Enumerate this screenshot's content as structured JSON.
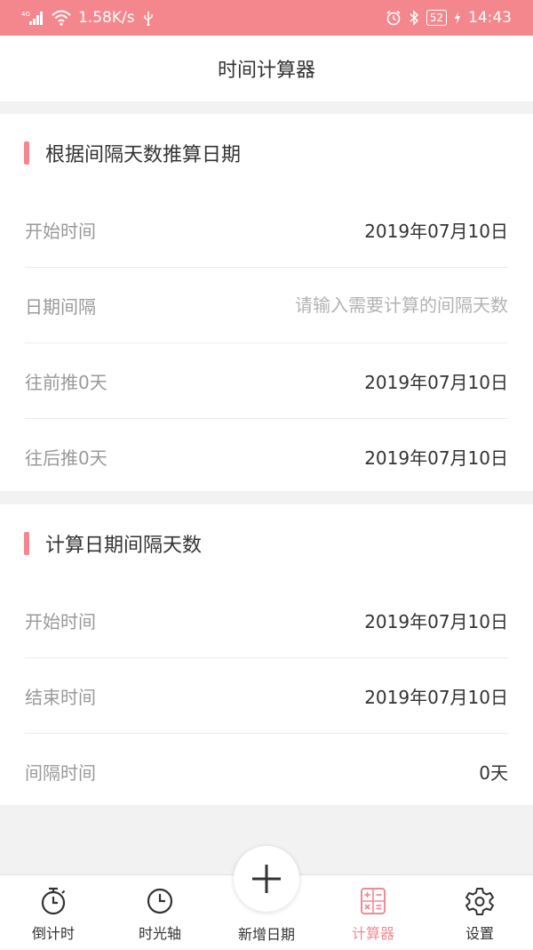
{
  "status_bar": {
    "network": "4G",
    "speed": "1.58K/s",
    "battery": "52",
    "time": "14:43"
  },
  "header": {
    "title": "时间计算器"
  },
  "section_interval": {
    "title": "根据间隔天数推算日期",
    "start_label": "开始时间",
    "start_value": "2019年07月10日",
    "interval_label": "日期间隔",
    "interval_placeholder": "请输入需要计算的间隔天数",
    "forward_label": "往前推0天",
    "forward_value": "2019年07月10日",
    "backward_label": "往后推0天",
    "backward_value": "2019年07月10日"
  },
  "section_diff": {
    "title": "计算日期间隔天数",
    "start_label": "开始时间",
    "start_value": "2019年07月10日",
    "end_label": "结束时间",
    "end_value": "2019年07月10日",
    "diff_label": "间隔时间",
    "diff_value": "0天"
  },
  "tabs": [
    {
      "label": "倒计时",
      "icon": "stopwatch-icon"
    },
    {
      "label": "时光轴",
      "icon": "clock-icon"
    },
    {
      "label": "新增日期",
      "icon": "plus-icon"
    },
    {
      "label": "计算器",
      "icon": "calculator-icon",
      "active": true
    },
    {
      "label": "设置",
      "icon": "gear-icon"
    }
  ],
  "colors": {
    "accent": "#f4878e",
    "active_tab": "#f08b95",
    "text_primary": "#333333",
    "text_secondary": "#9a9a9a",
    "background": "#f2f2f2"
  }
}
